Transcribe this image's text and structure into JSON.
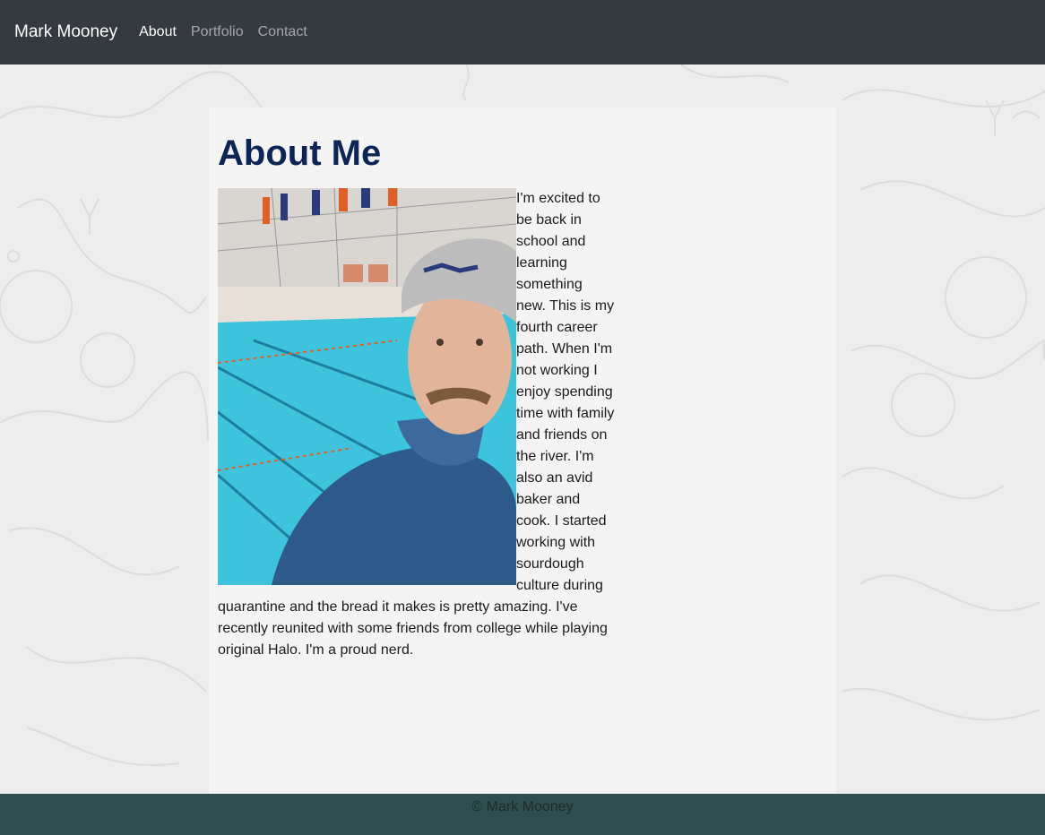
{
  "nav": {
    "brand": "Mark Mooney",
    "links": [
      {
        "label": "About",
        "active": true
      },
      {
        "label": "Portfolio",
        "active": false
      },
      {
        "label": "Contact",
        "active": false
      }
    ]
  },
  "main": {
    "title": "About Me",
    "bio": "I'm excited to be back in school and learning something new. This is my fourth career path. When I'm not working I enjoy spending time with family and friends on the river. I'm also an avid baker and cook. I started working with sourdough culture during quarantine and the bread it makes is pretty amazing. I've recently reunited with some friends from college while playing original Halo. I'm a proud nerd."
  },
  "footer": {
    "text": "© Mark Mooney"
  },
  "colors": {
    "navbar": "#343a40",
    "title": "#0d2456",
    "footer": "#2f4f4f"
  }
}
